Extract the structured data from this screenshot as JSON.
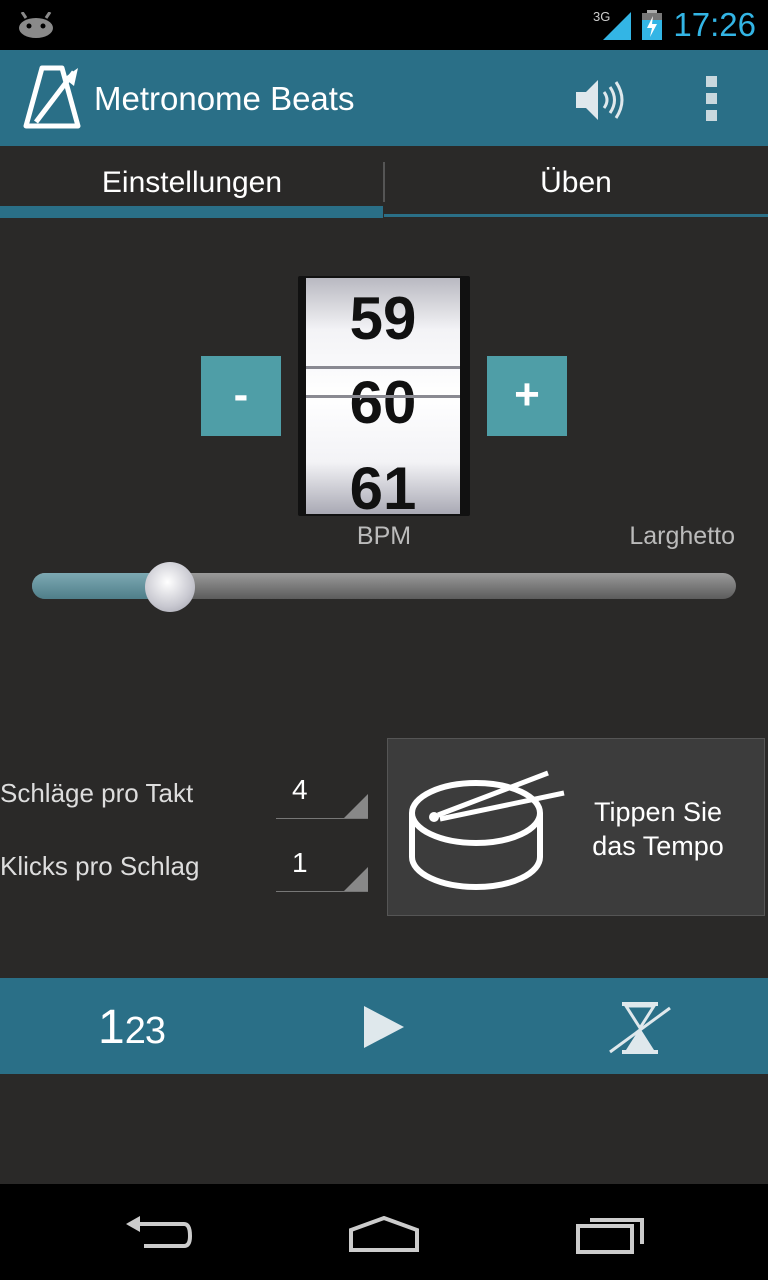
{
  "status_bar": {
    "network": "3G",
    "time": "17:26"
  },
  "action_bar": {
    "title": "Metronome Beats"
  },
  "tabs": [
    {
      "label": "Einstellungen"
    },
    {
      "label": "Üben"
    }
  ],
  "tempo": {
    "minus_label": "-",
    "plus_label": "+",
    "picker_values": [
      "59",
      "60",
      "61"
    ],
    "unit": "BPM",
    "tempo_name": "Larghetto",
    "slider_fraction": 0.2
  },
  "settings": [
    {
      "label": "Schläge pro Takt",
      "value": "4"
    },
    {
      "label": "Klicks pro Schlag",
      "value": "1"
    }
  ],
  "tap_tempo": {
    "label_line1": "Tippen Sie",
    "label_line2": "das Tempo"
  },
  "bottom_bar": {
    "counter_big": "1",
    "counter_small": "23"
  },
  "colors": {
    "accent": "#2a6f87",
    "button": "#4f9ea7",
    "status_time": "#33b5e5",
    "background": "#2a2928"
  }
}
